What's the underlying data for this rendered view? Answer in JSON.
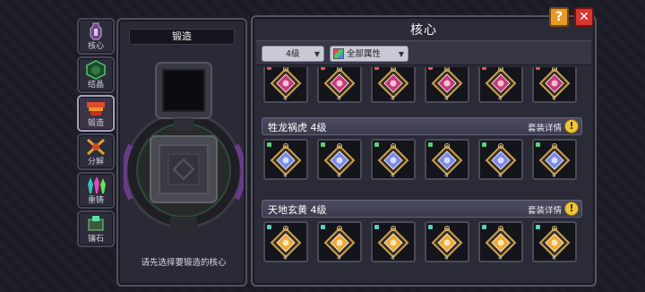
{
  "side_tabs": [
    {
      "label": "核心",
      "icon": "core-vase-icon",
      "active": false
    },
    {
      "label": "结晶",
      "icon": "crystal-hex-icon",
      "active": false
    },
    {
      "label": "锻造",
      "icon": "forge-anvil-icon",
      "active": true
    },
    {
      "label": "分解",
      "icon": "decompose-icon",
      "active": false
    },
    {
      "label": "重铸",
      "icon": "recast-crystals-icon",
      "active": false
    },
    {
      "label": "镶石",
      "icon": "inlay-stone-icon",
      "active": false
    }
  ],
  "forge": {
    "title": "锻造",
    "hint": "请先选择要锻造的核心"
  },
  "main": {
    "title": "核心",
    "filters": {
      "level": "4级",
      "attribute": "全部属性"
    },
    "sets": [
      {
        "name": "",
        "color": "#c83a7a",
        "dot_color": "#e05a5a",
        "items": [
          {
            "level": "4"
          },
          {
            "level": "4"
          },
          {
            "level": "4"
          },
          {
            "level": "4"
          },
          {
            "level": "4"
          },
          {
            "level": "4"
          }
        ]
      },
      {
        "name": "牲龙祸虎 4级",
        "detail": "套装详情",
        "color": "#7a8ae8",
        "dot_color": "#5ad07a",
        "items": [
          {
            "level": "4"
          },
          {
            "level": "4"
          },
          {
            "level": "4"
          },
          {
            "level": "4"
          },
          {
            "level": "4"
          },
          {
            "level": "4"
          }
        ]
      },
      {
        "name": "天地玄黄 4级",
        "detail": "套装详情",
        "color": "#f0a830",
        "dot_color": "#5ad0c0",
        "items": [
          {
            "level": "4"
          },
          {
            "level": "4"
          },
          {
            "level": "4"
          },
          {
            "level": "4"
          },
          {
            "level": "4"
          },
          {
            "level": "4"
          }
        ]
      }
    ]
  },
  "buttons": {
    "help": "?",
    "close": "✕"
  }
}
